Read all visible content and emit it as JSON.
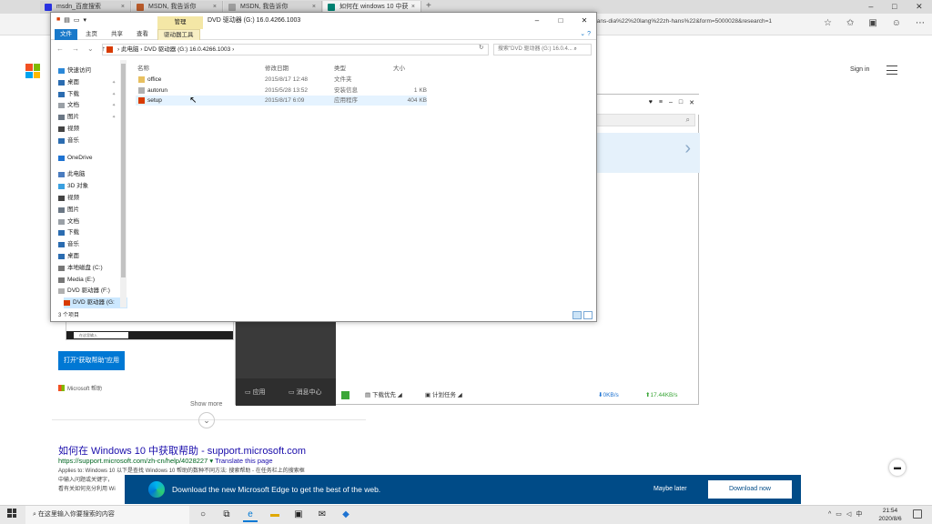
{
  "browser": {
    "tabs": [
      {
        "title": "msdn_百度搜索",
        "favicon_color": "#2932e1"
      },
      {
        "title": "MSDN, 我告诉你",
        "favicon_color": "#b85a2a"
      },
      {
        "title": "MSDN, 我告诉你",
        "favicon_color": "#9e9e9e"
      },
      {
        "title": "如何在 windows 10 中获",
        "favicon_color": "#008373"
      }
    ],
    "url_tail": "-hans-dia%22%20lang%22zh-hans%22&form=5000028&research=1"
  },
  "page": {
    "signin": "Sign in",
    "help_thumb_search": "在这里输入",
    "open_help_button": "打开\"获取帮助\"应用",
    "ms_help_label": "Microsoft 帮助",
    "show_more": "Show more",
    "result": {
      "title": "如何在 Windows 10 中获取帮助 - support.microsoft.com",
      "url": "https://support.microsoft.com/zh-cn/help/4028227",
      "translate": "Translate this page",
      "snippet_lines": [
        "Applies to: Windows 10 以下是查找 Windows 10 帮助的数种不同方法: 搜索帮助 - 在任务栏上的搜索框",
        "中输入问题或关键字，",
        "看有关如何充分利用 Wi"
      ]
    },
    "edge_banner": {
      "message": "Download the new Microsoft Edge to get the best of the web.",
      "maybe_later": "Maybe later",
      "download": "Download now"
    }
  },
  "download_manager": {
    "sidebar_apps": "应用",
    "sidebar_messages": "消息中心",
    "status": {
      "download_priority": "下载优先",
      "scheduled": "计划任务",
      "down_speed": "0KB/s",
      "up_speed": "17.44KB/s"
    }
  },
  "explorer": {
    "title": "DVD 驱动器 (G:) 16.0.4266.1003",
    "manage_tab": "管理",
    "ribbon_tabs": [
      "文件",
      "主页",
      "共享",
      "查看",
      "驱动器工具"
    ],
    "path": [
      "此电脑",
      "DVD 驱动器 (G:) 16.0.4266.1003"
    ],
    "search_placeholder": "搜索\"DVD 驱动器 (G:) 16.0.4...",
    "columns": {
      "name": "名称",
      "date": "修改日期",
      "type": "类型",
      "size": "大小"
    },
    "files": [
      {
        "name": "office",
        "date": "2015/8/17 12:48",
        "type": "文件夹",
        "size": "",
        "icon_color": "#e8c060"
      },
      {
        "name": "autorun",
        "date": "2015/5/28 13:52",
        "type": "安装信息",
        "size": "1 KB",
        "icon_color": "#b0b0b0"
      },
      {
        "name": "setup",
        "date": "2015/8/17 6:09",
        "type": "应用程序",
        "size": "404 KB",
        "icon_color": "#d83b01"
      }
    ],
    "nav": [
      {
        "label": "快速访问",
        "icon_color": "#2b88d8"
      },
      {
        "label": "桌面",
        "icon_color": "#2b6cb0",
        "pinned": true
      },
      {
        "label": "下载",
        "icon_color": "#2b6cb0",
        "pinned": true
      },
      {
        "label": "文档",
        "icon_color": "#9aa0a6",
        "pinned": true
      },
      {
        "label": "图片",
        "icon_color": "#6b7785",
        "pinned": true
      },
      {
        "label": "视频",
        "icon_color": "#444444"
      },
      {
        "label": "音乐",
        "icon_color": "#2b6cb0"
      },
      {
        "label": "OneDrive",
        "icon_color": "#1e73d2"
      },
      {
        "label": "此电脑",
        "icon_color": "#4a7cbf"
      },
      {
        "label": "3D 对象",
        "icon_color": "#3aa0e0"
      },
      {
        "label": "视频",
        "icon_color": "#444444"
      },
      {
        "label": "图片",
        "icon_color": "#6b7785"
      },
      {
        "label": "文档",
        "icon_color": "#9aa0a6"
      },
      {
        "label": "下载",
        "icon_color": "#2b6cb0"
      },
      {
        "label": "音乐",
        "icon_color": "#2b6cb0"
      },
      {
        "label": "桌面",
        "icon_color": "#2b6cb0"
      },
      {
        "label": "本地磁盘 (C:)",
        "icon_color": "#777777"
      },
      {
        "label": "Media (E:)",
        "icon_color": "#777777"
      },
      {
        "label": "DVD 驱动器 (F:)",
        "icon_color": "#b0b0b0"
      },
      {
        "label": "DVD 驱动器 (G:",
        "icon_color": "#d83b01",
        "selected": true
      }
    ],
    "status": "3 个项目"
  },
  "taskbar": {
    "search": "在这里输入你要搜索的内容",
    "time": "21:54",
    "date": "2020/8/6"
  },
  "colors": {
    "edge_banner": "#004b87",
    "accent": "#0078d4",
    "link": "#1a0dab",
    "url_green": "#006621"
  }
}
